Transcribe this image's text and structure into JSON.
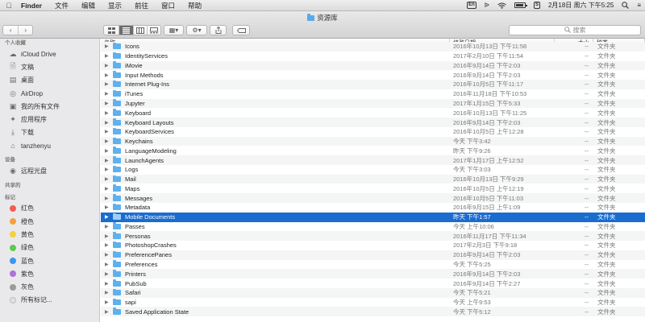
{
  "menubar": {
    "app": "Finder",
    "menus": [
      "文件",
      "编辑",
      "显示",
      "前往",
      "窗口",
      "帮助"
    ],
    "status": {
      "input_badge": "En",
      "bluetooth_badge": "S",
      "datetime": "2月18日 周六 下午5:25"
    }
  },
  "window": {
    "title": "资源库",
    "search_placeholder": "搜索"
  },
  "sidebar": {
    "favorites_header": "个人收藏",
    "favorites": [
      {
        "label": "iCloud Drive",
        "icon": "cloud-icon"
      },
      {
        "label": "文稿",
        "icon": "document-icon"
      },
      {
        "label": "桌面",
        "icon": "desktop-icon"
      },
      {
        "label": "AirDrop",
        "icon": "airdrop-icon"
      },
      {
        "label": "我的所有文件",
        "icon": "all-files-icon"
      },
      {
        "label": "应用程序",
        "icon": "applications-icon"
      },
      {
        "label": "下载",
        "icon": "download-icon"
      },
      {
        "label": "tanzhenyu",
        "icon": "home-icon"
      }
    ],
    "devices_header": "设备",
    "devices": [
      {
        "label": "远程光盘",
        "icon": "disc-icon"
      }
    ],
    "shared_header": "共享的",
    "tags_header": "标记",
    "tags": [
      {
        "label": "红色",
        "color": "#f45b54"
      },
      {
        "label": "橙色",
        "color": "#f4a13b"
      },
      {
        "label": "黄色",
        "color": "#f2d33c"
      },
      {
        "label": "绿色",
        "color": "#5ccb4e"
      },
      {
        "label": "蓝色",
        "color": "#3b95f5"
      },
      {
        "label": "紫色",
        "color": "#b16fd8"
      },
      {
        "label": "灰色",
        "color": "#9b9b9b"
      },
      {
        "label": "所有标记...",
        "color": "#e2e2e2"
      }
    ]
  },
  "columns": {
    "name": "名称",
    "date": "修改日期",
    "size": "大小",
    "kind": "种类"
  },
  "rows": [
    {
      "name": "Icons",
      "date": "2016年10月13日 下午11:58",
      "size": "--",
      "kind": "文件夹"
    },
    {
      "name": "IdentityServices",
      "date": "2017年2月10日 下午11:54",
      "size": "--",
      "kind": "文件夹"
    },
    {
      "name": "iMovie",
      "date": "2016年9月14日 下午2:03",
      "size": "--",
      "kind": "文件夹"
    },
    {
      "name": "Input Methods",
      "date": "2016年9月14日 下午2:03",
      "size": "--",
      "kind": "文件夹"
    },
    {
      "name": "Internet Plug-Ins",
      "date": "2016年10月5日 下午11:17",
      "size": "--",
      "kind": "文件夹"
    },
    {
      "name": "iTunes",
      "date": "2016年11月18日 下午10:53",
      "size": "--",
      "kind": "文件夹"
    },
    {
      "name": "Jupyter",
      "date": "2017年1月15日 下午5:33",
      "size": "--",
      "kind": "文件夹"
    },
    {
      "name": "Keyboard",
      "date": "2016年10月13日 下午11:25",
      "size": "--",
      "kind": "文件夹"
    },
    {
      "name": "Keyboard Layouts",
      "date": "2016年9月14日 下午2:03",
      "size": "--",
      "kind": "文件夹"
    },
    {
      "name": "KeyboardServices",
      "date": "2016年10月5日 上午12:28",
      "size": "--",
      "kind": "文件夹"
    },
    {
      "name": "Keychains",
      "date": "今天 下午3:42",
      "size": "--",
      "kind": "文件夹"
    },
    {
      "name": "LanguageModeling",
      "date": "昨天 下午9:26",
      "size": "--",
      "kind": "文件夹"
    },
    {
      "name": "LaunchAgents",
      "date": "2017年1月17日 上午12:52",
      "size": "--",
      "kind": "文件夹"
    },
    {
      "name": "Logs",
      "date": "今天 下午3:03",
      "size": "--",
      "kind": "文件夹"
    },
    {
      "name": "Mail",
      "date": "2016年10月13日 下午9:29",
      "size": "--",
      "kind": "文件夹"
    },
    {
      "name": "Maps",
      "date": "2016年10月5日 上午12:19",
      "size": "--",
      "kind": "文件夹"
    },
    {
      "name": "Messages",
      "date": "2016年10月5日 下午11:03",
      "size": "--",
      "kind": "文件夹"
    },
    {
      "name": "Metadata",
      "date": "2016年9月15日 上午1:09",
      "size": "--",
      "kind": "文件夹"
    },
    {
      "name": "Mobile Documents",
      "date": "昨天 下午1:57",
      "size": "--",
      "kind": "文件夹",
      "selected": true
    },
    {
      "name": "Passes",
      "date": "今天 上午10:06",
      "size": "--",
      "kind": "文件夹"
    },
    {
      "name": "Personas",
      "date": "2016年11月17日 下午11:34",
      "size": "--",
      "kind": "文件夹"
    },
    {
      "name": "PhotoshopCrashes",
      "date": "2017年2月3日 下午9:18",
      "size": "--",
      "kind": "文件夹"
    },
    {
      "name": "PreferencePanes",
      "date": "2016年9月14日 下午2:03",
      "size": "--",
      "kind": "文件夹"
    },
    {
      "name": "Preferences",
      "date": "今天 下午5:25",
      "size": "--",
      "kind": "文件夹"
    },
    {
      "name": "Printers",
      "date": "2016年9月14日 下午2:03",
      "size": "--",
      "kind": "文件夹"
    },
    {
      "name": "PubSub",
      "date": "2016年9月14日 下午2:27",
      "size": "--",
      "kind": "文件夹"
    },
    {
      "name": "Safari",
      "date": "今天 下午5:21",
      "size": "--",
      "kind": "文件夹"
    },
    {
      "name": "sapi",
      "date": "今天 上午9:53",
      "size": "--",
      "kind": "文件夹"
    },
    {
      "name": "Saved Application State",
      "date": "今天 下午5:12",
      "size": "--",
      "kind": "文件夹"
    }
  ]
}
